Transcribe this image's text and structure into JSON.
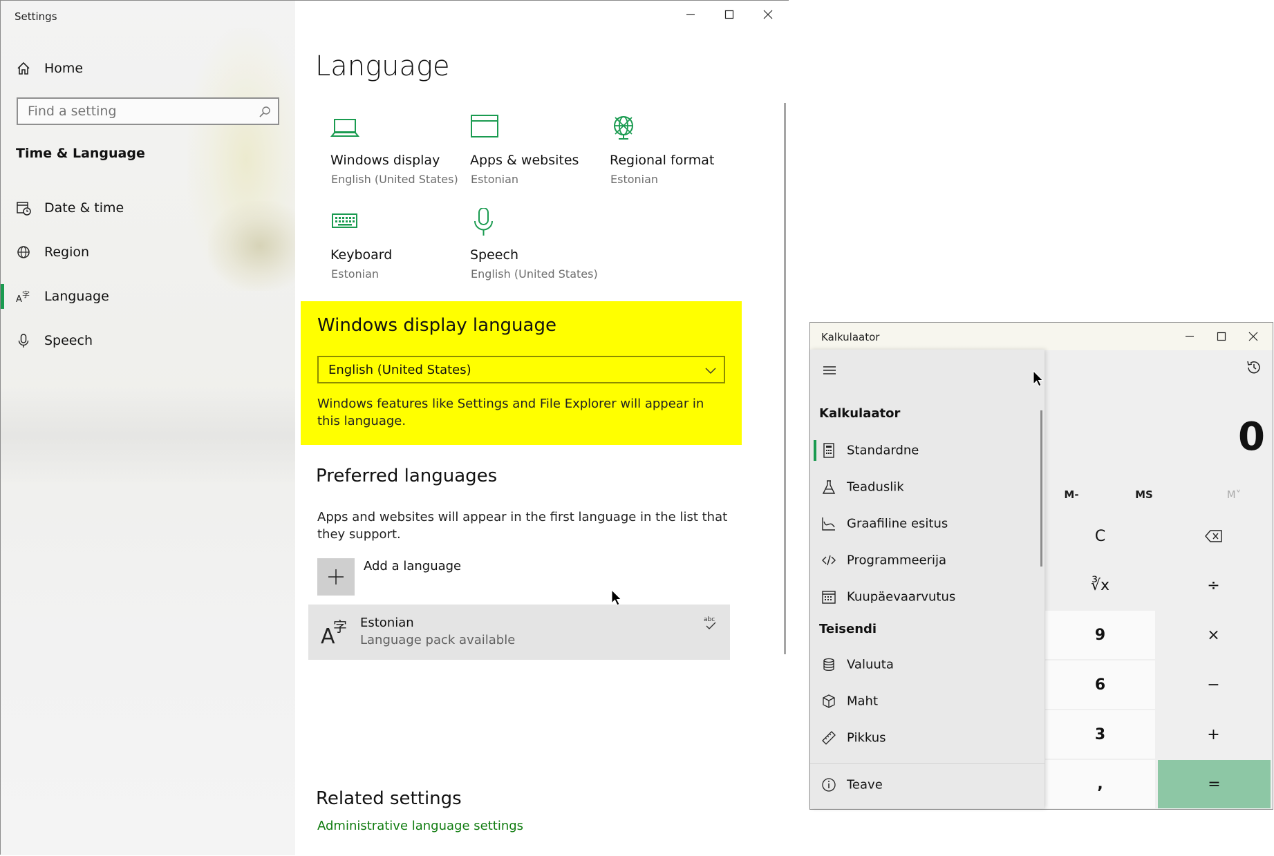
{
  "settings_window": {
    "title": "Settings",
    "search": {
      "placeholder": "Find a setting"
    },
    "nav": {
      "home": "Home",
      "section": "Time & Language",
      "items": [
        "Date & time",
        "Region",
        "Language",
        "Speech"
      ],
      "selected": "Language"
    },
    "page_title": "Language",
    "tiles": [
      {
        "label": "Windows display",
        "value": "English (United States)",
        "icon": "laptop-icon"
      },
      {
        "label": "Apps & websites",
        "value": "Estonian",
        "icon": "browser-window-icon"
      },
      {
        "label": "Regional format",
        "value": "Estonian",
        "icon": "globe-icon"
      },
      {
        "label": "Keyboard",
        "value": "Estonian",
        "icon": "keyboard-icon"
      },
      {
        "label": "Speech",
        "value": "English (United States)",
        "icon": "microphone-icon"
      }
    ],
    "display_language": {
      "heading": "Windows display language",
      "selected": "English (United States)",
      "description": "Windows features like Settings and File Explorer will appear in this language."
    },
    "preferred": {
      "heading": "Preferred languages",
      "description": "Apps and websites will appear in the first language in the list that they support.",
      "add_label": "Add a language",
      "languages": [
        {
          "name": "Estonian",
          "status": "Language pack available"
        }
      ]
    },
    "related": {
      "heading": "Related settings",
      "link": "Administrative language settings"
    },
    "accent_color": "#107c10",
    "highlight_color": "#ffff00"
  },
  "calculator_window": {
    "title": "Kalkulaator",
    "nav": {
      "calc_section": "Kalkulaator",
      "calc_items": [
        "Standardne",
        "Teaduslik",
        "Graafiline esitus",
        "Programmeerija",
        "Kuupäevaarvutus"
      ],
      "selected": "Standardne",
      "convert_section": "Teisendi",
      "convert_items": [
        "Valuuta",
        "Maht",
        "Pikkus"
      ],
      "about": "Teave"
    },
    "display": "0",
    "memory": {
      "m_minus": "M-",
      "ms": "MS",
      "m_list": "M˅"
    },
    "keys": {
      "clear": "C",
      "cube_root": "∛x",
      "divide": "÷",
      "nine": "9",
      "multiply": "×",
      "six": "6",
      "minus": "−",
      "three": "3",
      "plus": "+",
      "decimal": ",",
      "equals": "="
    },
    "equals_color": "#8dc7a5"
  }
}
